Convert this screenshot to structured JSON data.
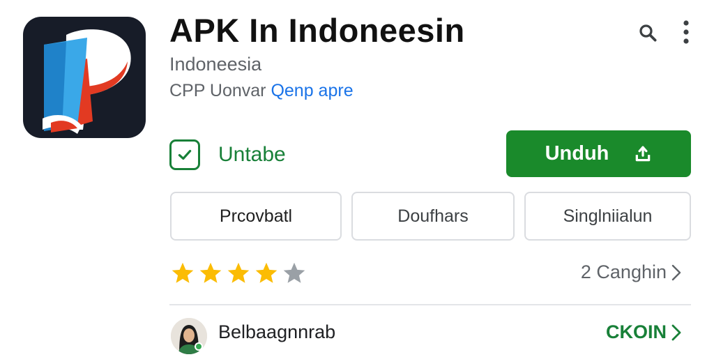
{
  "app": {
    "title": "APK In Indoneesin",
    "region": "Indoneesia",
    "developer_prefix": "CPP Uonvar",
    "developer_link": "Qenp apre",
    "icon": "app-logo-icon"
  },
  "header": {
    "search_icon": "search-icon",
    "more_icon": "more-vert-icon"
  },
  "status": {
    "label": "Untabe",
    "icon": "check-box-icon"
  },
  "install": {
    "label": "Unduh",
    "icon": "download-icon"
  },
  "chips": [
    {
      "label": "Prcovbatl"
    },
    {
      "label": "Doufhars"
    },
    {
      "label": "Singlniialun"
    }
  ],
  "rating": {
    "stars": 4,
    "max_stars": 5,
    "reviews_label": "2 Canghin"
  },
  "account": {
    "name": "Belbaagnnrab",
    "action_label": "CKOIN"
  },
  "colors": {
    "accent": "#1a8a2b",
    "status_green": "#188038",
    "star_filled": "#fbbc04",
    "star_empty": "#9aa0a6",
    "link_blue": "#1a73e8"
  }
}
